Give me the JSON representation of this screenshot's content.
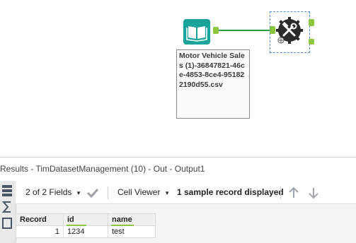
{
  "canvas": {
    "input_tool_icon": "book-icon",
    "macro_tool_icon": "tools-gear-icon",
    "annotation_text": "Motor Vehicle Sales (1)-36847821-46ce-4853-8ce4-951822190d55.csv",
    "connection_color": "#2e9e4a",
    "anchor_color": "#8cc63f",
    "input_tool_color": "#1aa39a"
  },
  "results": {
    "title": "Results - TimDatasetManagement (10) - Out - Output1",
    "toolbar": {
      "fields_label": "2 of 2 Fields",
      "viewer_label": "Cell Viewer",
      "sample_label": "1 sample record displayed"
    },
    "table": {
      "headers": [
        "Record",
        "id",
        "name"
      ],
      "rows": [
        [
          "1",
          "1234",
          "test"
        ]
      ]
    }
  }
}
